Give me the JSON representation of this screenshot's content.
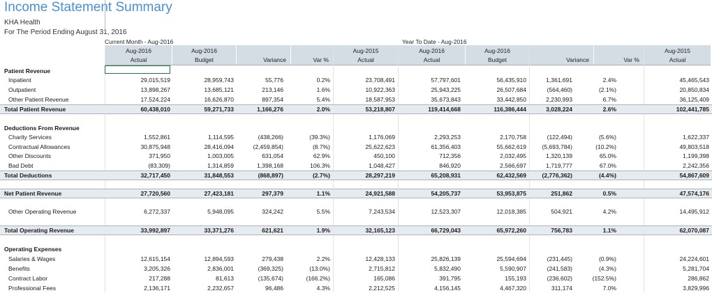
{
  "report": {
    "title": "Income Statement Summary",
    "org": "KHA Health",
    "period": "For The Period Ending August 31, 2016",
    "current_month_label": "Current Month - Aug-2016",
    "ytd_label": "Year To Date - Aug-2016"
  },
  "columns": [
    {
      "l1": "Aug-2016",
      "l2": "Actual"
    },
    {
      "l1": "Aug-2016",
      "l2": "Budget"
    },
    {
      "l1": "",
      "l2": "Variance"
    },
    {
      "l1": "",
      "l2": "Var %"
    },
    {
      "l1": "Aug-2015",
      "l2": "Actual"
    },
    {
      "l1": "Aug-2016",
      "l2": "Actual"
    },
    {
      "l1": "Aug-2016",
      "l2": "Budget"
    },
    {
      "l1": "",
      "l2": "Variance"
    },
    {
      "l1": "",
      "l2": "Var %"
    },
    {
      "l1": "Aug-2015",
      "l2": "Actual"
    }
  ],
  "rows": [
    {
      "type": "section",
      "label": "Patient Revenue",
      "values": []
    },
    {
      "type": "item",
      "label": "Inpatient",
      "values": [
        "29,015,519",
        "28,959,743",
        "55,776",
        "0.2%",
        "23,708,491",
        "57,797,601",
        "56,435,910",
        "1,361,691",
        "2.4%",
        "45,465,543"
      ]
    },
    {
      "type": "item",
      "label": "Outpatient",
      "values": [
        "13,898,267",
        "13,685,121",
        "213,146",
        "1.6%",
        "10,922,363",
        "25,943,225",
        "26,507,684",
        "(564,460)",
        "(2.1%)",
        "20,850,834"
      ]
    },
    {
      "type": "item",
      "label": "Other Patient Revenue",
      "values": [
        "17,524,224",
        "16,626,870",
        "897,354",
        "5.4%",
        "18,587,953",
        "35,673,843",
        "33,442,850",
        "2,230,993",
        "6.7%",
        "36,125,409"
      ]
    },
    {
      "type": "total",
      "label": "Total Patient Revenue",
      "values": [
        "60,438,010",
        "59,271,733",
        "1,166,276",
        "2.0%",
        "53,218,807",
        "119,414,668",
        "116,386,444",
        "3,028,224",
        "2.6%",
        "102,441,785"
      ]
    },
    {
      "type": "section",
      "label": "Deductions From Revenue",
      "values": []
    },
    {
      "type": "item",
      "label": "Charity Services",
      "values": [
        "1,552,861",
        "1,114,595",
        "(438,266)",
        "(39.3%)",
        "1,176,069",
        "2,293,253",
        "2,170,758",
        "(122,494)",
        "(5.6%)",
        "1,622,337"
      ]
    },
    {
      "type": "item",
      "label": "Contractual Allowances",
      "values": [
        "30,875,948",
        "28,416,094",
        "(2,459,854)",
        "(8.7%)",
        "25,622,623",
        "61,356,403",
        "55,662,619",
        "(5,693,784)",
        "(10.2%)",
        "49,803,518"
      ]
    },
    {
      "type": "item",
      "label": "Other Discounts",
      "values": [
        "371,950",
        "1,003,005",
        "631,054",
        "62.9%",
        "450,100",
        "712,356",
        "2,032,495",
        "1,320,139",
        "65.0%",
        "1,199,398"
      ]
    },
    {
      "type": "item",
      "label": "Bad Debt",
      "values": [
        "(83,309)",
        "1,314,859",
        "1,398,168",
        "106.3%",
        "1,048,427",
        "846,920",
        "2,566,697",
        "1,719,777",
        "67.0%",
        "2,242,356"
      ]
    },
    {
      "type": "total",
      "label": "Total Deductions",
      "values": [
        "32,717,450",
        "31,848,553",
        "(868,897)",
        "(2.7%)",
        "28,297,219",
        "65,208,931",
        "62,432,569",
        "(2,776,362)",
        "(4.4%)",
        "54,867,609"
      ]
    },
    {
      "type": "total",
      "label": "Net Patient Revenue",
      "values": [
        "27,720,560",
        "27,423,181",
        "297,379",
        "1.1%",
        "24,921,588",
        "54,205,737",
        "53,953,875",
        "251,862",
        "0.5%",
        "47,574,176"
      ]
    },
    {
      "type": "item",
      "label": "Other Operating Revenue",
      "values": [
        "6,272,337",
        "5,948,095",
        "324,242",
        "5.5%",
        "7,243,534",
        "12,523,307",
        "12,018,385",
        "504,921",
        "4.2%",
        "14,495,912"
      ]
    },
    {
      "type": "total",
      "label": "Total Operating Revenue",
      "values": [
        "33,992,897",
        "33,371,276",
        "621,621",
        "1.9%",
        "32,165,123",
        "66,729,043",
        "65,972,260",
        "756,783",
        "1.1%",
        "62,070,087"
      ]
    },
    {
      "type": "section",
      "label": "Operating Expenses",
      "values": []
    },
    {
      "type": "item",
      "label": "Salaries & Wages",
      "values": [
        "12,615,154",
        "12,894,593",
        "279,438",
        "2.2%",
        "12,428,133",
        "25,826,139",
        "25,594,694",
        "(231,445)",
        "(0.9%)",
        "24,224,601"
      ]
    },
    {
      "type": "item",
      "label": "Benefits",
      "values": [
        "3,205,326",
        "2,836,001",
        "(369,325)",
        "(13.0%)",
        "2,715,812",
        "5,832,490",
        "5,590,907",
        "(241,583)",
        "(4.3%)",
        "5,281,704"
      ]
    },
    {
      "type": "item",
      "label": "Contract Labor",
      "values": [
        "217,288",
        "81,613",
        "(135,674)",
        "(166.2%)",
        "165,086",
        "391,795",
        "155,193",
        "(236,602)",
        "(152.5%)",
        "286,862"
      ]
    },
    {
      "type": "item",
      "label": "Professional Fees",
      "values": [
        "2,136,171",
        "2,232,657",
        "96,486",
        "4.3%",
        "2,212,525",
        "4,156,145",
        "4,467,320",
        "311,174",
        "7.0%",
        "3,829,996"
      ]
    }
  ]
}
